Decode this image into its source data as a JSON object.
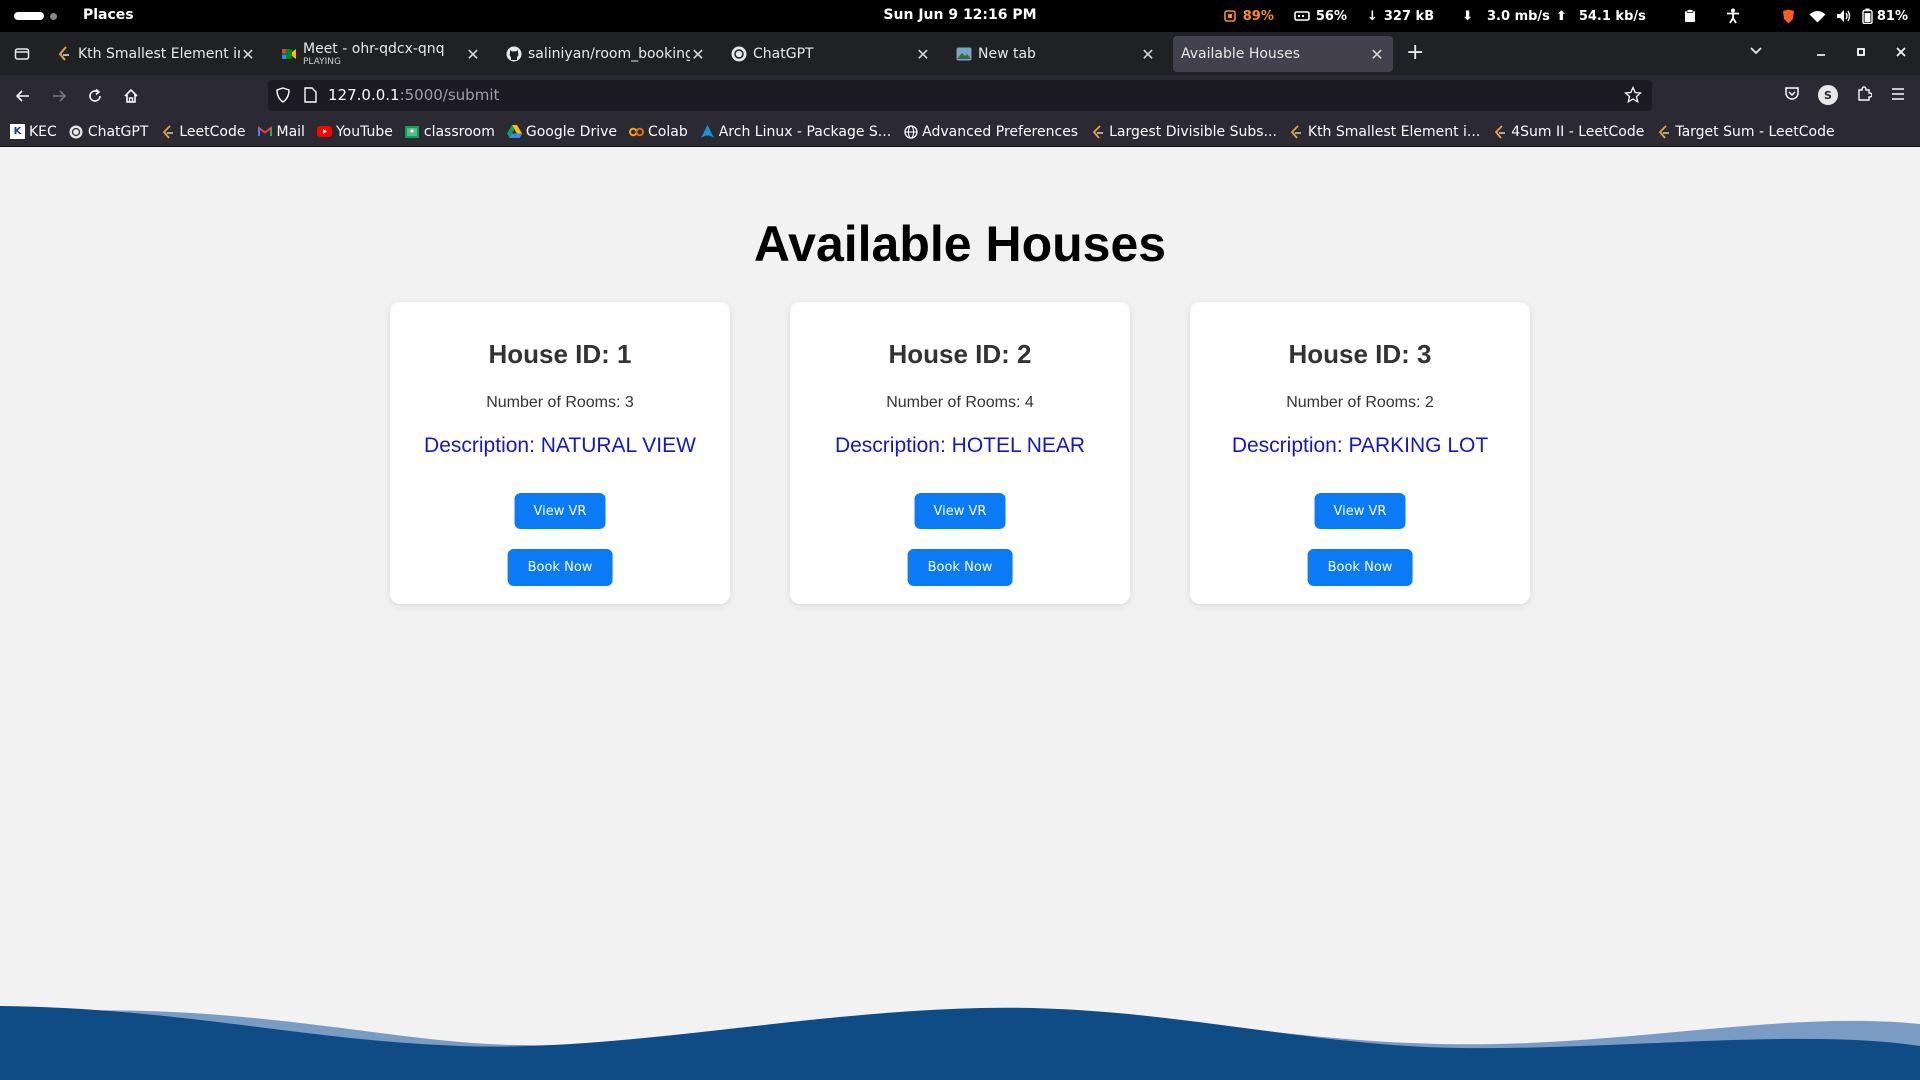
{
  "system_bar": {
    "places": "Places",
    "clock": "Sun Jun 9  12:16 PM",
    "cpu": "89%",
    "memory": "56%",
    "net_total": "327 kB",
    "download": "3.0 mb/s",
    "upload": "54.1 kb/s",
    "battery": "81%"
  },
  "tabs": [
    {
      "title": "Kth Smallest Element in a",
      "subtitle": "",
      "active": false
    },
    {
      "title": "Meet - ohr-qdcx-qnq",
      "subtitle": "PLAYING",
      "active": false
    },
    {
      "title": "saliniyan/room_booking",
      "subtitle": "",
      "active": false
    },
    {
      "title": "ChatGPT",
      "subtitle": "",
      "active": false
    },
    {
      "title": "New tab",
      "subtitle": "",
      "active": false
    },
    {
      "title": "Available Houses",
      "subtitle": "",
      "active": true
    }
  ],
  "address_bar": {
    "host": "127.0.0.1",
    "path": ":5000/submit"
  },
  "profile_initial": "S",
  "bookmarks": [
    {
      "label": "KEC",
      "icon": "kec-icon"
    },
    {
      "label": "ChatGPT",
      "icon": "chatgpt-icon"
    },
    {
      "label": "LeetCode",
      "icon": "leetcode-icon"
    },
    {
      "label": "Mail",
      "icon": "gmail-icon"
    },
    {
      "label": "YouTube",
      "icon": "youtube-icon"
    },
    {
      "label": "classroom",
      "icon": "classroom-icon"
    },
    {
      "label": "Google Drive",
      "icon": "drive-icon"
    },
    {
      "label": "Colab",
      "icon": "colab-icon"
    },
    {
      "label": "Arch Linux - Package S...",
      "icon": "arch-icon"
    },
    {
      "label": "Advanced Preferences",
      "icon": "globe-icon"
    },
    {
      "label": "Largest Divisible Subs...",
      "icon": "leetcode-icon"
    },
    {
      "label": "Kth Smallest Element i...",
      "icon": "leetcode-icon"
    },
    {
      "label": "4Sum II - LeetCode",
      "icon": "leetcode-icon"
    },
    {
      "label": "Target Sum - LeetCode",
      "icon": "leetcode-icon"
    }
  ],
  "page": {
    "title": "Available Houses",
    "houses": [
      {
        "id_label": "House ID: 1",
        "rooms": "Number of Rooms: 3",
        "description": "Description: NATURAL VIEW",
        "vr_label": "View VR",
        "book_label": "Book Now"
      },
      {
        "id_label": "House ID: 2",
        "rooms": "Number of Rooms: 4",
        "description": "Description: HOTEL NEAR",
        "vr_label": "View VR",
        "book_label": "Book Now"
      },
      {
        "id_label": "House ID: 3",
        "rooms": "Number of Rooms: 2",
        "description": "Description: PARKING LOT",
        "vr_label": "View VR",
        "book_label": "Book Now"
      }
    ]
  },
  "colors": {
    "button": "#0b7bf5",
    "description": "#1616c8",
    "wave_dark": "#0f4c86",
    "wave_light": "#7a9cc4"
  }
}
